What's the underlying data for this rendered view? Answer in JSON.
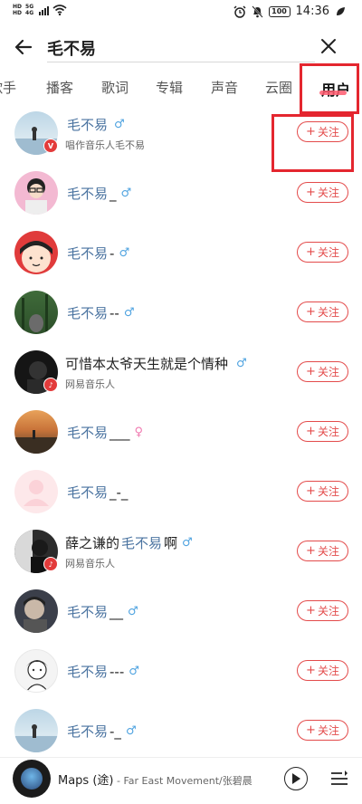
{
  "status_bar": {
    "sim1": "HD",
    "sim2": "HD",
    "net1": "5G",
    "net2": "4G",
    "battery": "100",
    "time": "14:36"
  },
  "search": {
    "query": "毛不易"
  },
  "tabs": [
    {
      "label": "歌手",
      "active": false
    },
    {
      "label": "播客",
      "active": false
    },
    {
      "label": "歌词",
      "active": false
    },
    {
      "label": "专辑",
      "active": false
    },
    {
      "label": "声音",
      "active": false
    },
    {
      "label": "云圈",
      "active": false
    },
    {
      "label": "用户",
      "active": true
    }
  ],
  "follow_label": "关注",
  "users": [
    {
      "name_prefix": "",
      "name_hl": "毛不易",
      "name_suffix": "",
      "gender": "♂",
      "gender_type": "m",
      "subtitle": "唱作音乐人毛不易",
      "badge": "V"
    },
    {
      "name_prefix": "",
      "name_hl": "毛不易",
      "name_suffix": "_",
      "gender": "♂",
      "gender_type": "m",
      "subtitle": "",
      "badge": ""
    },
    {
      "name_prefix": "",
      "name_hl": "毛不易",
      "name_suffix": "-",
      "gender": "♂",
      "gender_type": "m",
      "subtitle": "",
      "badge": ""
    },
    {
      "name_prefix": "",
      "name_hl": "毛不易",
      "name_suffix": "--",
      "gender": "♂",
      "gender_type": "m",
      "subtitle": "",
      "badge": ""
    },
    {
      "name_prefix": "可惜本太爷天生就是个情种",
      "name_hl": "",
      "name_suffix": "",
      "gender": "♂",
      "gender_type": "m",
      "subtitle": "网易音乐人",
      "badge": "♪"
    },
    {
      "name_prefix": "",
      "name_hl": "毛不易",
      "name_suffix": "___",
      "gender": "♀",
      "gender_type": "f",
      "subtitle": "",
      "badge": ""
    },
    {
      "name_prefix": "",
      "name_hl": "毛不易",
      "name_suffix": "_-_",
      "gender": "",
      "gender_type": "",
      "subtitle": "",
      "badge": ""
    },
    {
      "name_prefix": "薛之谦的",
      "name_hl": "毛不易",
      "name_suffix": "啊",
      "gender": "♂",
      "gender_type": "m",
      "subtitle": "网易音乐人",
      "badge": "♪"
    },
    {
      "name_prefix": "",
      "name_hl": "毛不易",
      "name_suffix": "__",
      "gender": "♂",
      "gender_type": "m",
      "subtitle": "",
      "badge": ""
    },
    {
      "name_prefix": "",
      "name_hl": "毛不易",
      "name_suffix": "---",
      "gender": "♂",
      "gender_type": "m",
      "subtitle": "",
      "badge": ""
    },
    {
      "name_prefix": "",
      "name_hl": "毛不易",
      "name_suffix": "-_",
      "gender": "♂",
      "gender_type": "m",
      "subtitle": "",
      "badge": ""
    }
  ],
  "player": {
    "song": "Maps (途)",
    "artist": " - Far East Movement/张碧晨"
  },
  "colors": {
    "accent": "#e34b4b",
    "highlight_name": "#4a73a0",
    "annotation_box": "#e4262f"
  }
}
